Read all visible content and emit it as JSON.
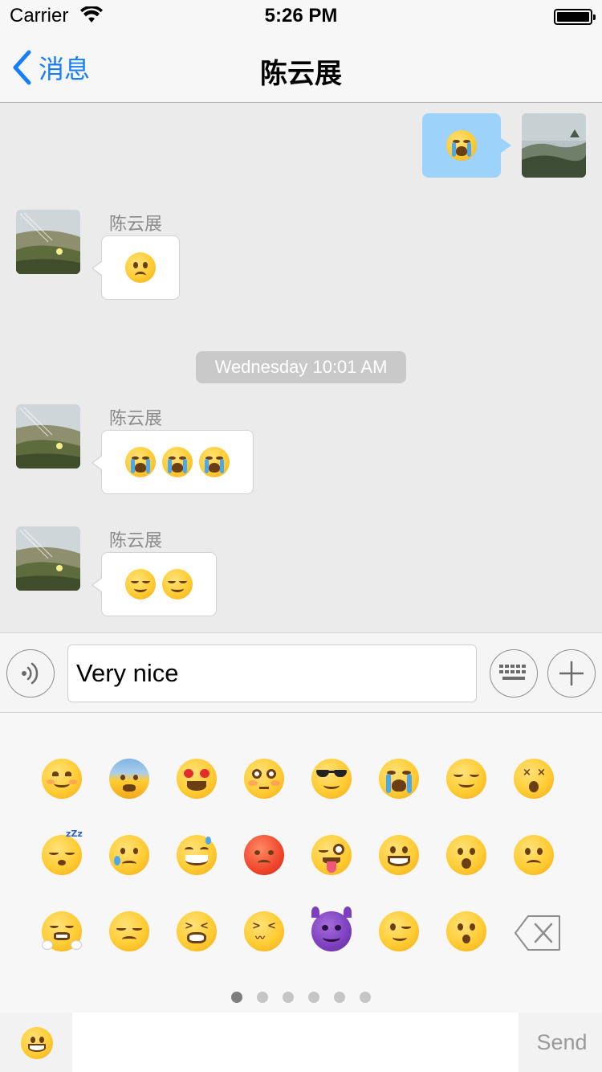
{
  "status_bar": {
    "carrier": "Carrier",
    "time": "5:26 PM",
    "wifi_icon": "wifi-icon",
    "battery_icon": "battery-icon"
  },
  "nav": {
    "back_label": "消息",
    "title": "陈云展"
  },
  "messages": [
    {
      "direction": "outgoing",
      "emojis": [
        "loudly-crying-face"
      ]
    },
    {
      "direction": "incoming",
      "sender": "陈云展",
      "emojis": [
        "worried-face"
      ]
    },
    {
      "type": "timestamp",
      "text": "Wednesday 10:01 AM"
    },
    {
      "direction": "incoming",
      "sender": "陈云展",
      "emojis": [
        "loudly-crying-face",
        "loudly-crying-face",
        "loudly-crying-face"
      ]
    },
    {
      "direction": "incoming",
      "sender": "陈云展",
      "emojis": [
        "relieved-face",
        "relieved-face"
      ]
    }
  ],
  "composer": {
    "text": "Very nice",
    "voice_icon": "voice-icon",
    "keyboard_icon": "keyboard-icon",
    "plus_icon": "plus-icon"
  },
  "emoji_keyboard": {
    "rows": [
      [
        "smiling-face",
        "fearful-face",
        "heart-eyes-face",
        "flushed-face",
        "sunglasses-face",
        "loudly-crying-face",
        "relieved-face",
        "dizzy-face"
      ],
      [
        "sleeping-face",
        "crying-face",
        "grinning-sweat-face",
        "pouting-face",
        "winking-tongue-face",
        "grinning-face",
        "hushed-face",
        "worried-face"
      ],
      [
        "triumph-face",
        "disappointed-face",
        "tired-face",
        "confounded-face",
        "smiling-imp",
        "winking-face",
        "astonished-face"
      ]
    ],
    "delete_icon": "backspace-icon",
    "pages": 6,
    "current_page": 1
  },
  "bottom_bar": {
    "emoji_toggle_icon": "smiley-icon",
    "send_label": "Send"
  },
  "colors": {
    "accent": "#157efb",
    "chat_background": "#ebebeb",
    "outgoing_bubble": "#9dd2fb",
    "incoming_bubble": "#ffffff"
  }
}
